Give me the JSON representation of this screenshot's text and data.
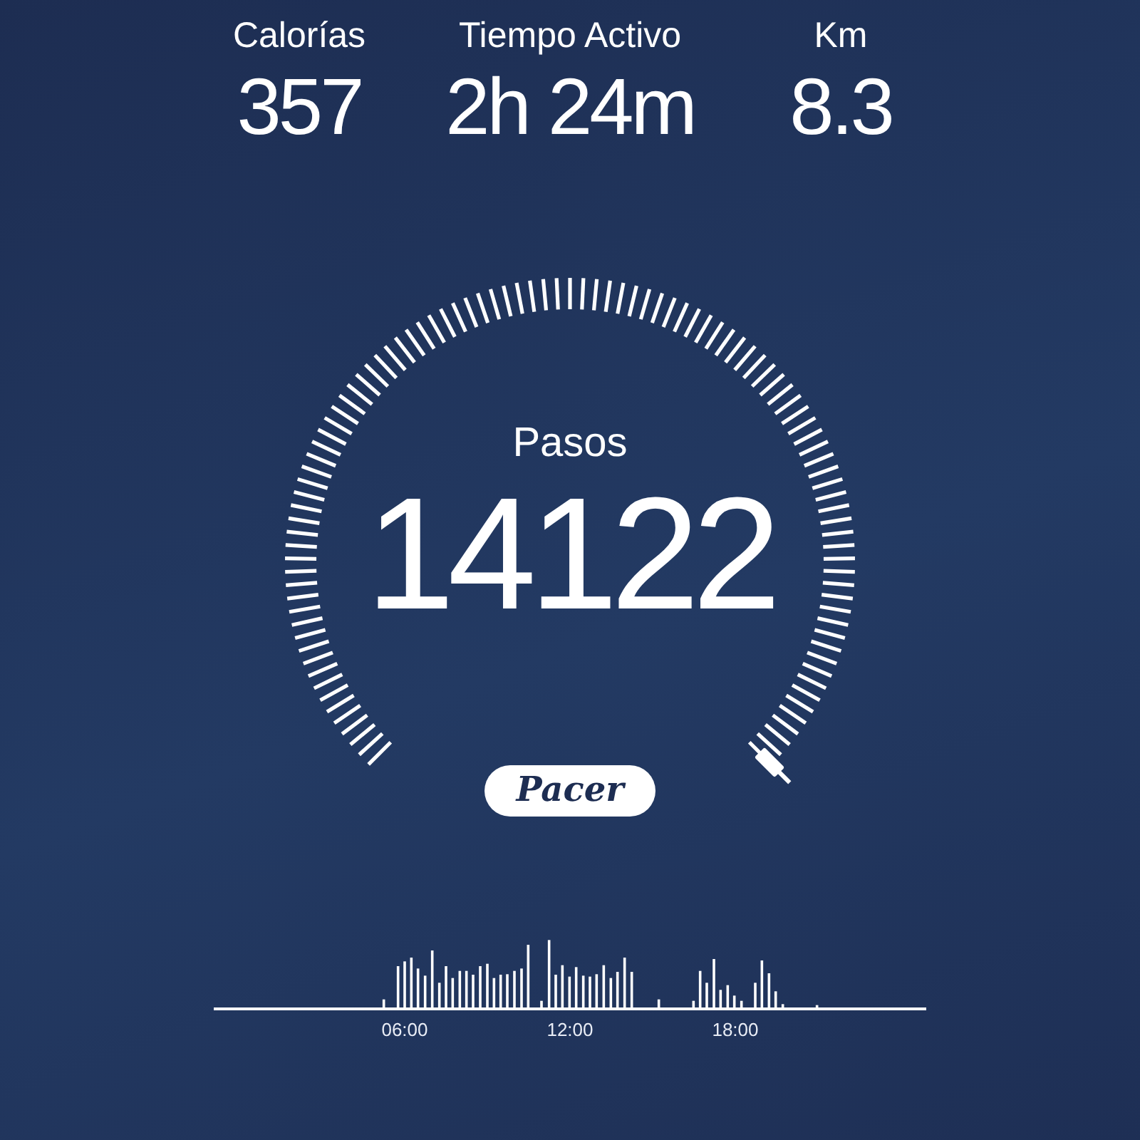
{
  "stats": [
    {
      "label": "Calorías",
      "value": "357"
    },
    {
      "label": "Tiempo Activo",
      "value": "2h 24m"
    },
    {
      "label": "Km",
      "value": "8.3"
    }
  ],
  "gauge": {
    "label": "Pasos",
    "value": "14122"
  },
  "logo": "Pacer",
  "activity_chart": {
    "time_labels": [
      "06:00",
      "12:00",
      "18:00"
    ]
  }
}
